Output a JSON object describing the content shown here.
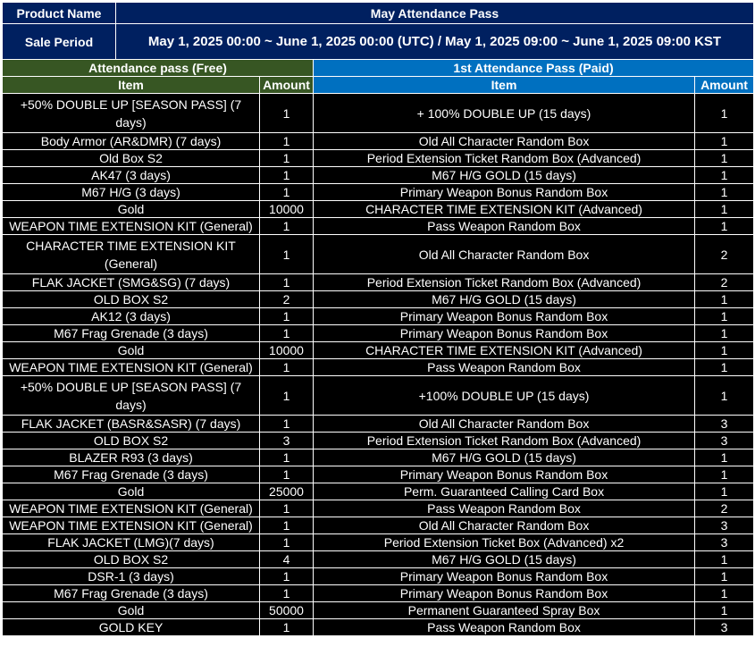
{
  "product_label": "Product Name",
  "product_value": "May Attendance Pass",
  "period_label": "Sale Period",
  "period_value": "May 1, 2025 00:00 ~ June 1, 2025 00:00 (UTC) / May 1, 2025 09:00 ~ June 1, 2025 09:00 KST",
  "free_title": "Attendance pass (Free)",
  "paid_title": "1st Attendance Pass (Paid)",
  "col_item": "Item",
  "col_amount": "Amount",
  "colors": {
    "navy": "#002060",
    "green": "#375623",
    "blue": "#0070c0",
    "cell": "#000000"
  },
  "rows": [
    [
      "+50% DOUBLE UP [SEASON PASS] (7 days)",
      "1",
      "+ 100% DOUBLE UP (15 days)",
      "1"
    ],
    [
      "Body Armor (AR&DMR) (7 days)",
      "1",
      "Old All Character Random Box",
      "1"
    ],
    [
      "Old Box S2",
      "1",
      "Period Extension Ticket Random Box (Advanced)",
      "1"
    ],
    [
      "AK47 (3 days)",
      "1",
      "M67 H/G GOLD (15 days)",
      "1"
    ],
    [
      "M67 H/G (3 days)",
      "1",
      "Primary Weapon Bonus Random Box",
      "1"
    ],
    [
      "Gold",
      "10000",
      "CHARACTER TIME EXTENSION KIT (Advanced)",
      "1"
    ],
    [
      "WEAPON TIME EXTENSION KIT (General)",
      "1",
      "Pass Weapon Random Box",
      "1"
    ],
    [
      "CHARACTER TIME EXTENSION KIT (General)",
      "1",
      "Old All Character Random Box",
      "2"
    ],
    [
      "FLAK JACKET (SMG&SG) (7 days)",
      "1",
      "Period Extension Ticket Random Box (Advanced)",
      "2"
    ],
    [
      "OLD BOX S2",
      "2",
      "M67 H/G GOLD (15 days)",
      "1"
    ],
    [
      "AK12 (3 days)",
      "1",
      "Primary Weapon Bonus Random Box",
      "1"
    ],
    [
      "M67 Frag Grenade (3 days)",
      "1",
      "Primary Weapon Bonus Random Box",
      "1"
    ],
    [
      "Gold",
      "10000",
      "CHARACTER TIME EXTENSION KIT (Advanced)",
      "1"
    ],
    [
      "WEAPON TIME EXTENSION KIT (General)",
      "1",
      "Pass Weapon Random Box",
      "1"
    ],
    [
      "+50% DOUBLE UP [SEASON PASS] (7 days)",
      "1",
      "+100% DOUBLE UP (15 days)",
      "1"
    ],
    [
      "FLAK JACKET (BASR&SASR) (7 days)",
      "1",
      "Old All Character Random Box",
      "3"
    ],
    [
      "OLD BOX S2",
      "3",
      "Period Extension Ticket Random Box (Advanced)",
      "3"
    ],
    [
      "BLAZER R93 (3 days)",
      "1",
      "M67 H/G GOLD (15 days)",
      "1"
    ],
    [
      "M67 Frag Grenade (3 days)",
      "1",
      "Primary Weapon Bonus Random Box",
      "1"
    ],
    [
      "Gold",
      "25000",
      "Perm. Guaranteed Calling Card Box",
      "1"
    ],
    [
      "WEAPON TIME EXTENSION KIT (General)",
      "1",
      "Pass Weapon Random Box",
      "2"
    ],
    [
      "WEAPON TIME EXTENSION KIT (General)",
      "1",
      "Old All Character Random Box",
      "3"
    ],
    [
      "FLAK JACKET (LMG)(7 days)",
      "1",
      "Period Extension Ticket Box (Advanced) x2",
      "3"
    ],
    [
      "OLD BOX S2",
      "4",
      "M67 H/G GOLD (15 days)",
      "1"
    ],
    [
      "DSR-1 (3 days)",
      "1",
      "Primary Weapon Bonus Random Box",
      "1"
    ],
    [
      "M67 Frag Grenade (3 days)",
      "1",
      "Primary Weapon Bonus Random Box",
      "1"
    ],
    [
      "Gold",
      "50000",
      "Permanent Guaranteed Spray Box",
      "1"
    ],
    [
      "GOLD KEY",
      "1",
      "Pass Weapon Random Box",
      "3"
    ]
  ]
}
